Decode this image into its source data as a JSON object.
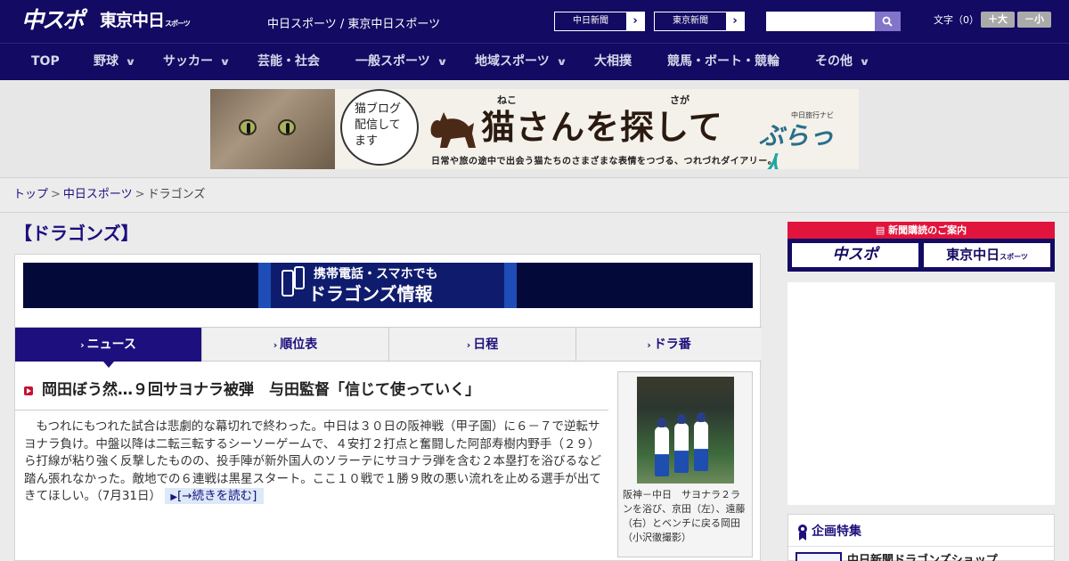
{
  "header": {
    "logo_main": "中スポ",
    "logo_tokyo": "東京中日",
    "logo_tokyo_small": "スポーツ",
    "site_tagline": "中日スポーツ / 東京中日スポーツ",
    "paper_links": [
      "中日新聞",
      "東京新聞"
    ],
    "search_placeholder": "",
    "font_size_label": "文字（0）",
    "font_larger": "＋大",
    "font_smaller": "－小"
  },
  "nav": {
    "items": [
      {
        "label": "TOP",
        "has_menu": false
      },
      {
        "label": "野球",
        "has_menu": true
      },
      {
        "label": "サッカー",
        "has_menu": true
      },
      {
        "label": "芸能・社会",
        "has_menu": false
      },
      {
        "label": "一般スポーツ",
        "has_menu": true
      },
      {
        "label": "地域スポーツ",
        "has_menu": true
      },
      {
        "label": "大相撲",
        "has_menu": false
      },
      {
        "label": "競馬・ボート・競輪",
        "has_menu": false
      },
      {
        "label": "その他",
        "has_menu": true
      }
    ]
  },
  "banner": {
    "speech_line1": "猫ブログ",
    "speech_line2": "配信して",
    "speech_line3": "ます",
    "ruby_neko": "ねこ",
    "ruby_saga": "さが",
    "title": "猫さんを探して",
    "subtitle": "日常や旅の途中で出会う猫たちのさまざまな表情をつづる、つれづれダイアリー。",
    "brand_small": "中日旅行ナビ",
    "brand": "ぶらっ",
    "brand_accent": "人"
  },
  "breadcrumb": {
    "items": [
      "トップ",
      "中日スポーツ"
    ],
    "current": "ドラゴンズ"
  },
  "page": {
    "title": "【ドラゴンズ】"
  },
  "mobile_banner": {
    "line1": "携帯電話・スマホでも",
    "line2": "ドラゴンズ情報"
  },
  "tabs": [
    {
      "label": "ニュース",
      "active": true
    },
    {
      "label": "順位表",
      "active": false
    },
    {
      "label": "日程",
      "active": false
    },
    {
      "label": "ドラ番",
      "active": false
    }
  ],
  "article": {
    "title": "岡田ぼう然…９回サヨナラ被弾　与田監督「信じて使っていく」",
    "body": "もつれにもつれた試合は悲劇的な幕切れで終わった。中日は３０日の阪神戦（甲子園）に６－７で逆転サヨナラ負け。中盤以降は二転三転するシーソーゲームで、４安打２打点と奮闘した阿部寿樹内野手（２９）ら打線が粘り強く反撃したものの、投手陣が新外国人のソラーテにサヨナラ弾を含む２本塁打を浴びるなど踏ん張れなかった。敵地での６連戦は黒星スタート。ここ１０戦で１勝９敗の悪い流れを止める選手が出てきてほしい。",
    "date": "（7月31日）",
    "read_more": "[→続きを読む]",
    "photo_caption": "阪神－中日　サヨナラ２ランを浴び、京田（左）、遠藤（右）とベンチに戻る岡田（小沢徹撮影）"
  },
  "sidebar": {
    "subscribe_header": "新聞購読のご案内",
    "subscribe_left": "中スポ",
    "subscribe_right": "東京中日",
    "subscribe_right_small": "スポーツ",
    "feature_title": "企画特集",
    "feature_item": "中日新聞ドラゴンズショップ"
  },
  "colors": {
    "navy": "#130a63",
    "link": "#1d0f7d",
    "accent_red": "#e0143c"
  }
}
